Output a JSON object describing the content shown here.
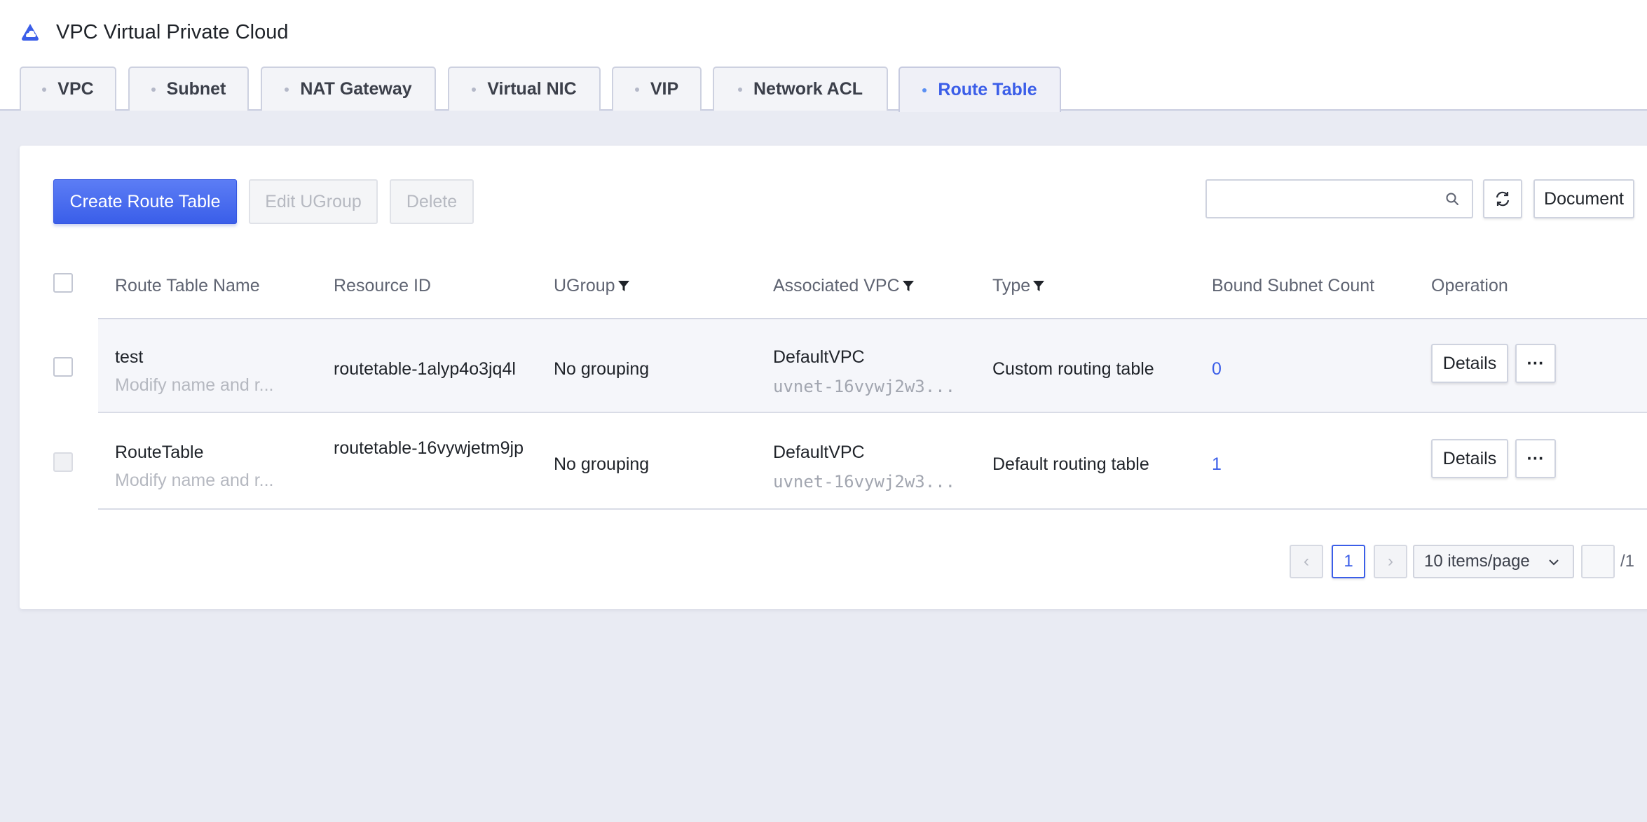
{
  "app": {
    "title": "VPC Virtual Private Cloud",
    "logo_icon": "cloud-logo-icon",
    "accent_color": "#3b5ee8"
  },
  "tabs": [
    {
      "label": "VPC",
      "active": false
    },
    {
      "label": "Subnet",
      "active": false
    },
    {
      "label": "NAT Gateway",
      "active": false
    },
    {
      "label": "Virtual NIC",
      "active": false
    },
    {
      "label": "VIP",
      "active": false
    },
    {
      "label": "Network ACL",
      "active": false
    },
    {
      "label": "Route Table",
      "active": true
    }
  ],
  "toolbar": {
    "create_label": "Create Route Table",
    "edit_ugroup_label": "Edit UGroup",
    "delete_label": "Delete",
    "search_value": "",
    "search_placeholder": "",
    "refresh_icon": "refresh-icon",
    "document_label": "Document"
  },
  "table": {
    "columns": [
      {
        "label": "Route Table Name",
        "filter": false
      },
      {
        "label": "Resource ID",
        "filter": false
      },
      {
        "label": "UGroup",
        "filter": true
      },
      {
        "label": "Associated VPC",
        "filter": true
      },
      {
        "label": "Type",
        "filter": true
      },
      {
        "label": "Bound Subnet Count",
        "filter": false
      },
      {
        "label": "Operation",
        "filter": false
      }
    ],
    "rows": [
      {
        "name": "test",
        "remark": "Modify name and r...",
        "resource_id": "routetable-1alyp4o3jq4l",
        "ugroup": "No grouping",
        "vpc_name": "DefaultVPC",
        "vpc_id": "uvnet-16vywj2w3...",
        "type": "Custom routing table",
        "subnet_count": "0",
        "details_label": "Details",
        "more_label": "···",
        "highlighted": true,
        "checkbox_disabled": false
      },
      {
        "name": "RouteTable",
        "remark": "Modify name and r...",
        "resource_id": "routetable-16vywjetm9jp",
        "ugroup": "No grouping",
        "vpc_name": "DefaultVPC",
        "vpc_id": "uvnet-16vywj2w3...",
        "type": "Default routing table",
        "subnet_count": "1",
        "details_label": "Details",
        "more_label": "···",
        "highlighted": false,
        "checkbox_disabled": true
      }
    ]
  },
  "pagination": {
    "prev": "‹",
    "next": "›",
    "current_page": "1",
    "page_size": "10 items/page",
    "goto_value": "",
    "total_pages": "/1"
  }
}
